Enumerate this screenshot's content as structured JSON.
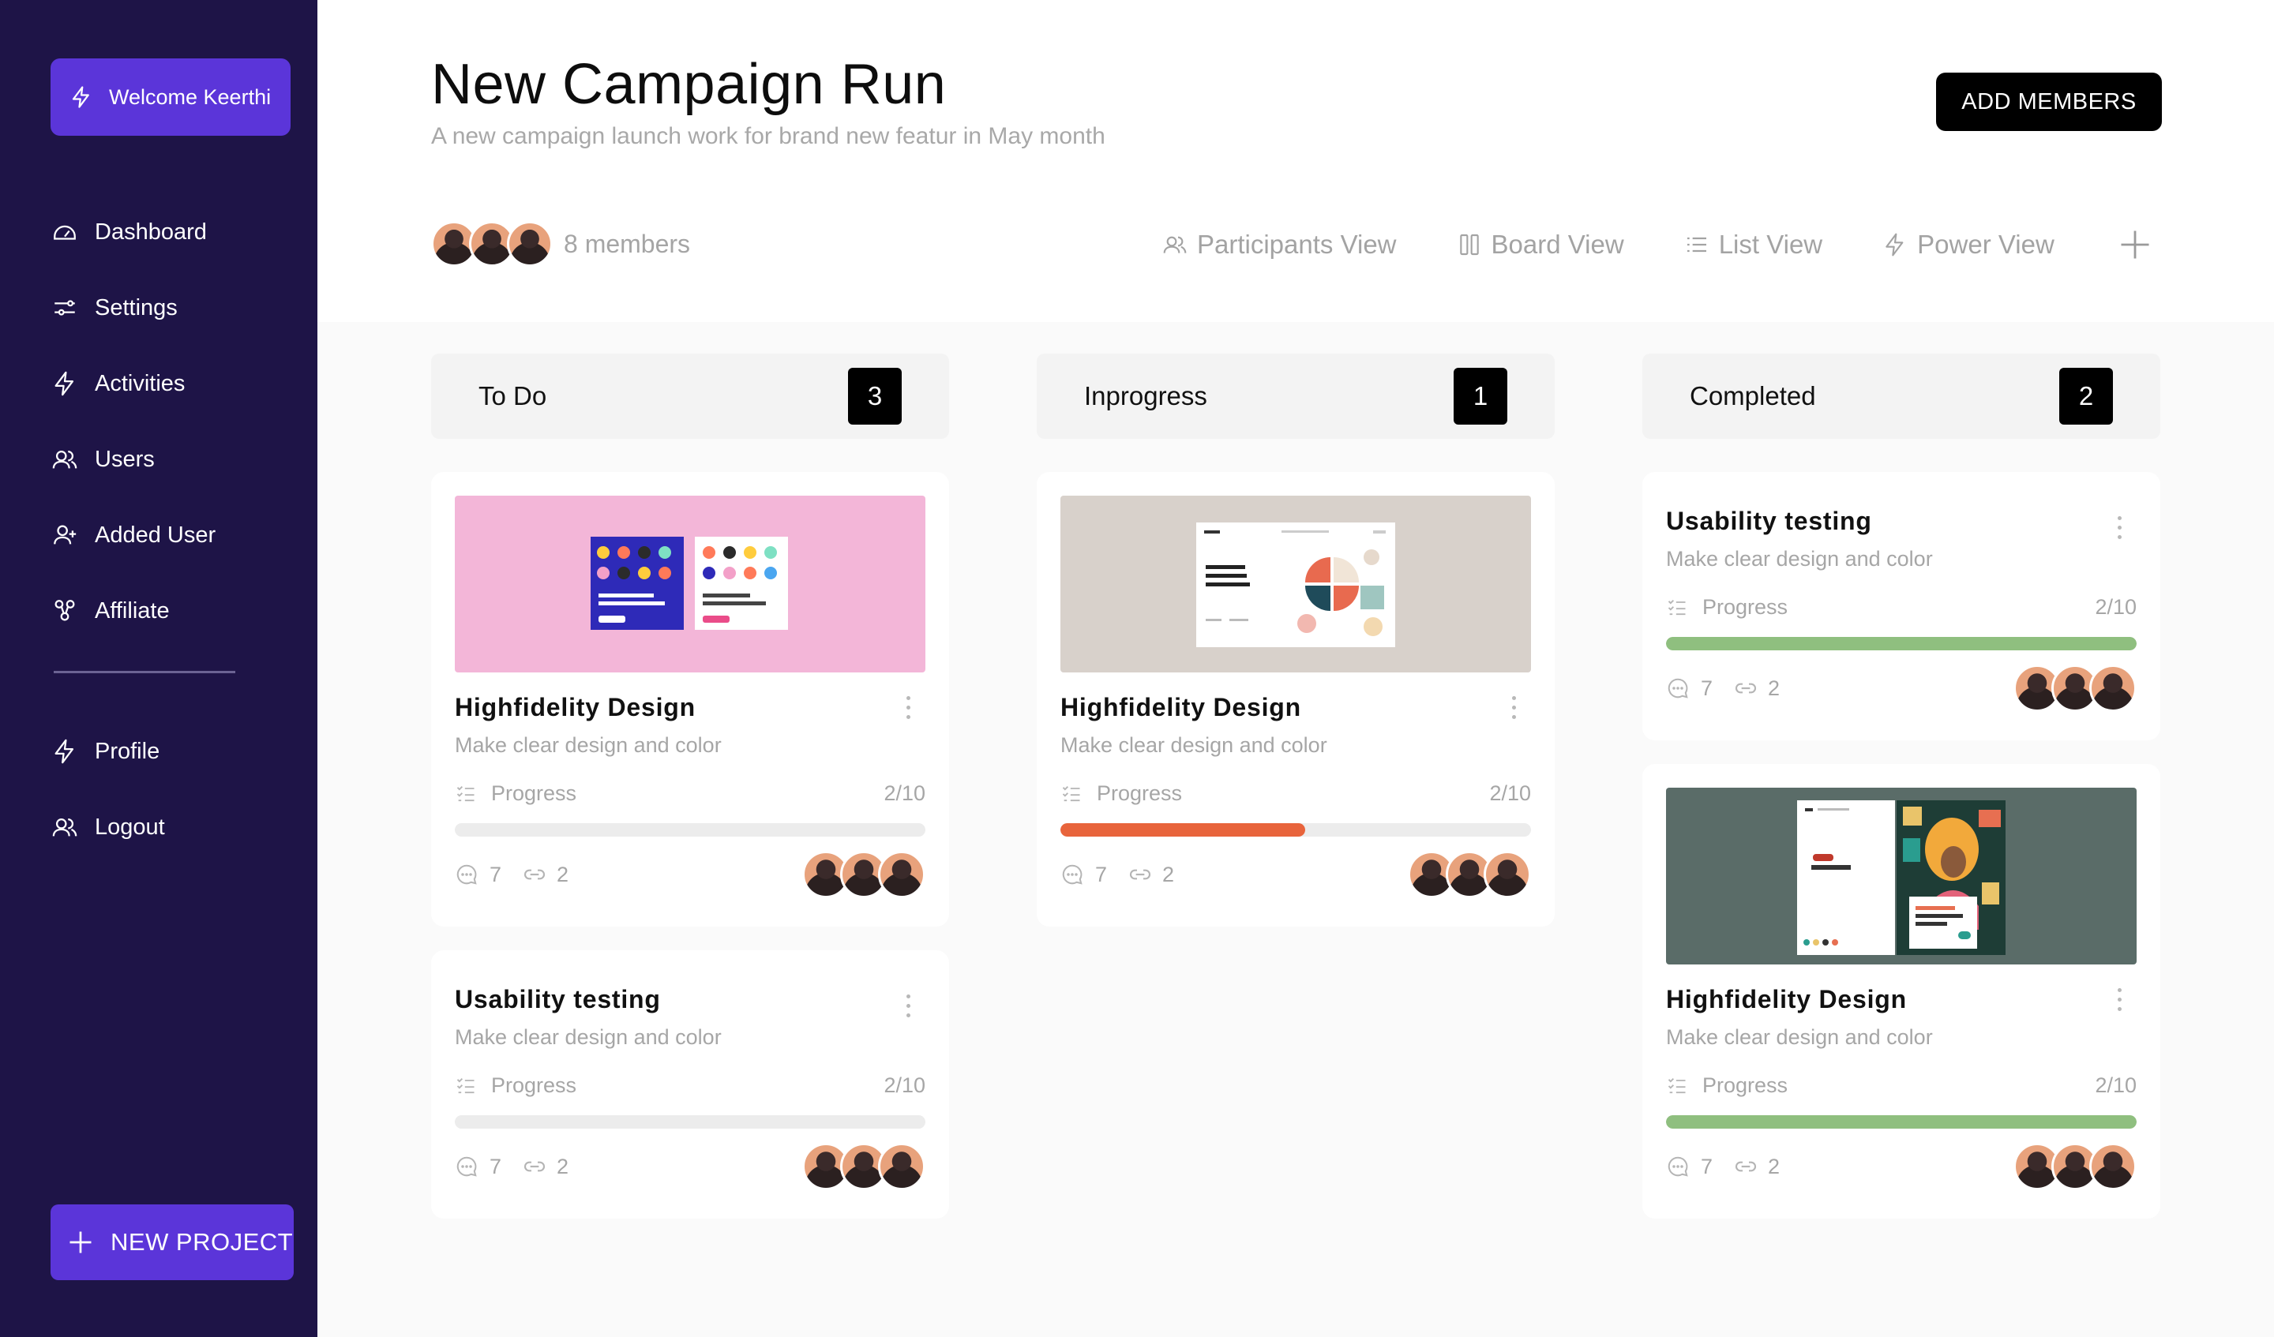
{
  "sidebar": {
    "welcome": "Welcome Keerthi",
    "nav": [
      {
        "label": "Dashboard",
        "icon": "gauge-icon"
      },
      {
        "label": "Settings",
        "icon": "sliders-icon"
      },
      {
        "label": "Activities",
        "icon": "bolt-icon"
      },
      {
        "label": "Users",
        "icon": "users-icon"
      },
      {
        "label": "Added User",
        "icon": "user-plus-icon"
      },
      {
        "label": "Affiliate",
        "icon": "affiliate-icon"
      }
    ],
    "nav2": [
      {
        "label": "Profile",
        "icon": "bolt-icon"
      },
      {
        "label": "Logout",
        "icon": "users-icon"
      }
    ],
    "new_project": "NEW PROJECT"
  },
  "header": {
    "title": "New Campaign Run",
    "subtitle": "A new campaign launch work for brand new featur in May month",
    "add_members": "ADD MEMBERS",
    "members_text": "8 members",
    "views": [
      {
        "label": "Participants View",
        "icon": "users-icon"
      },
      {
        "label": "Board View",
        "icon": "board-icon"
      },
      {
        "label": "List View",
        "icon": "list-icon"
      },
      {
        "label": "Power View",
        "icon": "bolt-icon"
      }
    ]
  },
  "colors": {
    "sidebar_bg": "#1e1447",
    "accent": "#5b35d9",
    "progress_orange": "#e8643c",
    "progress_green": "#8fbf7f"
  },
  "columns": [
    {
      "title": "To Do",
      "count": "3",
      "cards": [
        {
          "title": "Highfidelity Design",
          "desc": "Make clear design and color",
          "progress_label": "Progress",
          "progress_value": "2/10",
          "progress_fraction": 0,
          "comments": "7",
          "links": "2",
          "thumbnail": "pink"
        },
        {
          "title": "Usability testing",
          "desc": "Make clear design and color",
          "progress_label": "Progress",
          "progress_value": "2/10",
          "progress_fraction": 0,
          "comments": "7",
          "links": "2",
          "thumbnail": null
        }
      ]
    },
    {
      "title": "Inprogress",
      "count": "1",
      "cards": [
        {
          "title": "Highfidelity Design",
          "desc": "Make clear design and color",
          "progress_label": "Progress",
          "progress_value": "2/10",
          "progress_fraction": 0.52,
          "comments": "7",
          "links": "2",
          "thumbnail": "beige"
        }
      ]
    },
    {
      "title": "Completed",
      "count": "2",
      "cards": [
        {
          "title": "Usability testing",
          "desc": "Make clear design and color",
          "progress_label": "Progress",
          "progress_value": "2/10",
          "progress_fraction": 1,
          "comments": "7",
          "links": "2",
          "thumbnail": null
        },
        {
          "title": "Highfidelity Design",
          "desc": "Make clear design and color",
          "progress_label": "Progress",
          "progress_value": "2/10",
          "progress_fraction": 1,
          "comments": "7",
          "links": "2",
          "thumbnail": "green"
        }
      ]
    }
  ]
}
